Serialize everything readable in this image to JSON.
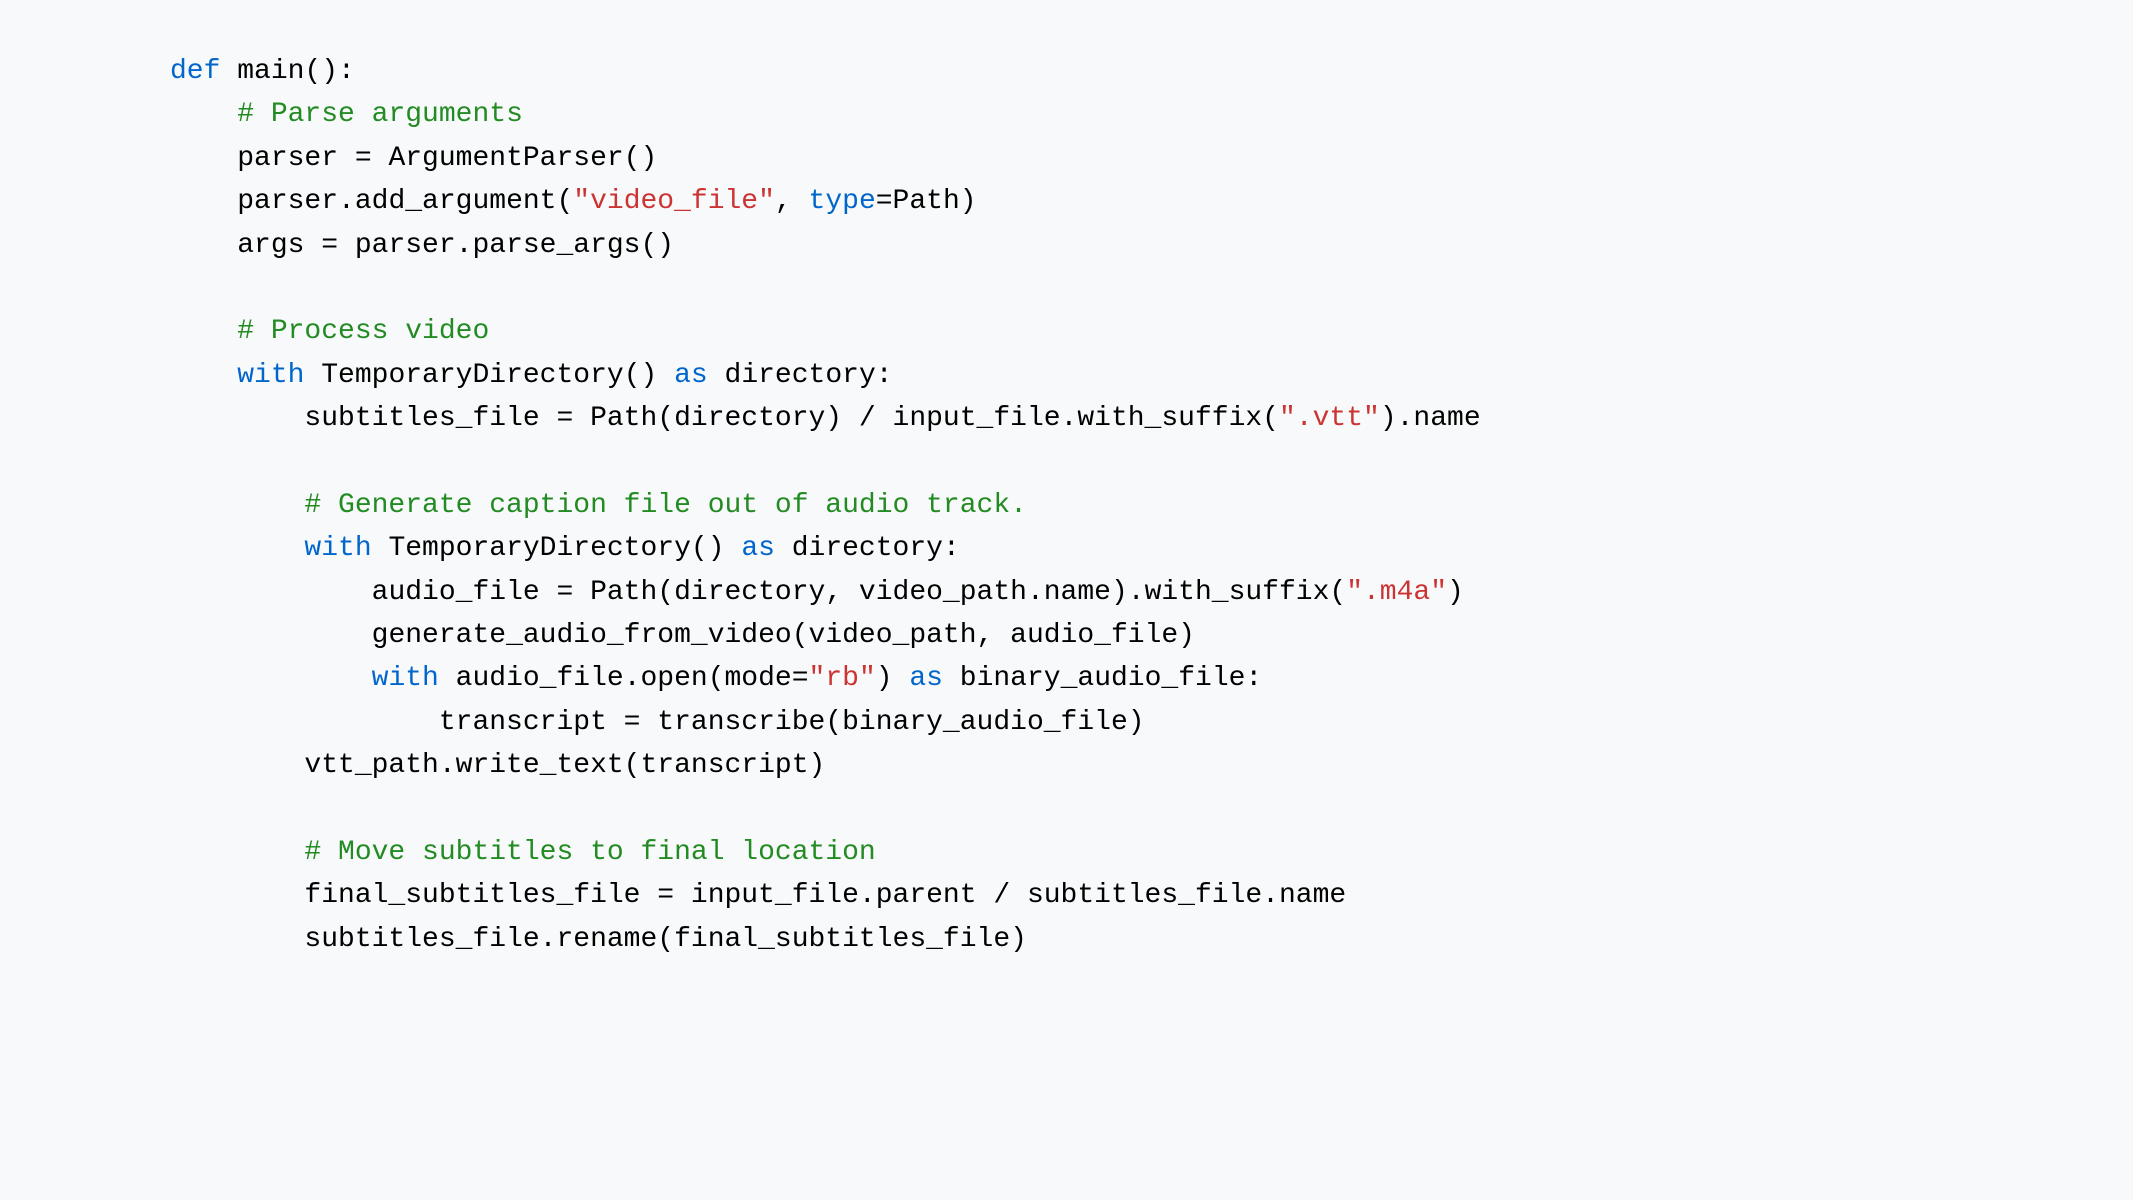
{
  "code": {
    "line1": {
      "def": "def",
      "rest": " main():"
    },
    "line2": {
      "indent": "    ",
      "comment": "# Parse arguments"
    },
    "line3": {
      "indent": "    ",
      "text": "parser = ArgumentParser()"
    },
    "line4": {
      "indent": "    ",
      "pre": "parser.add_argument(",
      "str": "\"video_file\"",
      "mid": ", ",
      "type": "type",
      "post": "=Path)"
    },
    "line5": {
      "indent": "    ",
      "text": "args = parser.parse_args()"
    },
    "line6": {
      "indent": "    ",
      "comment": "# Process video"
    },
    "line7": {
      "indent": "    ",
      "with": "with",
      "mid": " TemporaryDirectory() ",
      "as": "as",
      "post": " directory:"
    },
    "line8": {
      "indent": "        ",
      "pre": "subtitles_file = Path(directory) / input_file.with_suffix(",
      "str": "\".vtt\"",
      "post": ").name"
    },
    "line9": {
      "indent": "        ",
      "comment": "# Generate caption file out of audio track."
    },
    "line10": {
      "indent": "        ",
      "with": "with",
      "mid": " TemporaryDirectory() ",
      "as": "as",
      "post": " directory:"
    },
    "line11": {
      "indent": "            ",
      "pre": "audio_file = Path(directory, video_path.name).with_suffix(",
      "str": "\".m4a\"",
      "post": ")"
    },
    "line12": {
      "indent": "            ",
      "text": "generate_audio_from_video(video_path, audio_file)"
    },
    "line13": {
      "indent": "            ",
      "with": "with",
      "mid": " audio_file.open(mode=",
      "str": "\"rb\"",
      "mid2": ") ",
      "as": "as",
      "post": " binary_audio_file:"
    },
    "line14": {
      "indent": "                ",
      "text": "transcript = transcribe(binary_audio_file)"
    },
    "line15": {
      "indent": "        ",
      "text": "vtt_path.write_text(transcript)"
    },
    "line16": {
      "indent": "        ",
      "comment": "# Move subtitles to final location"
    },
    "line17": {
      "indent": "        ",
      "text": "final_subtitles_file = input_file.parent / subtitles_file.name"
    },
    "line18": {
      "indent": "        ",
      "text": "subtitles_file.rename(final_subtitles_file)"
    }
  }
}
